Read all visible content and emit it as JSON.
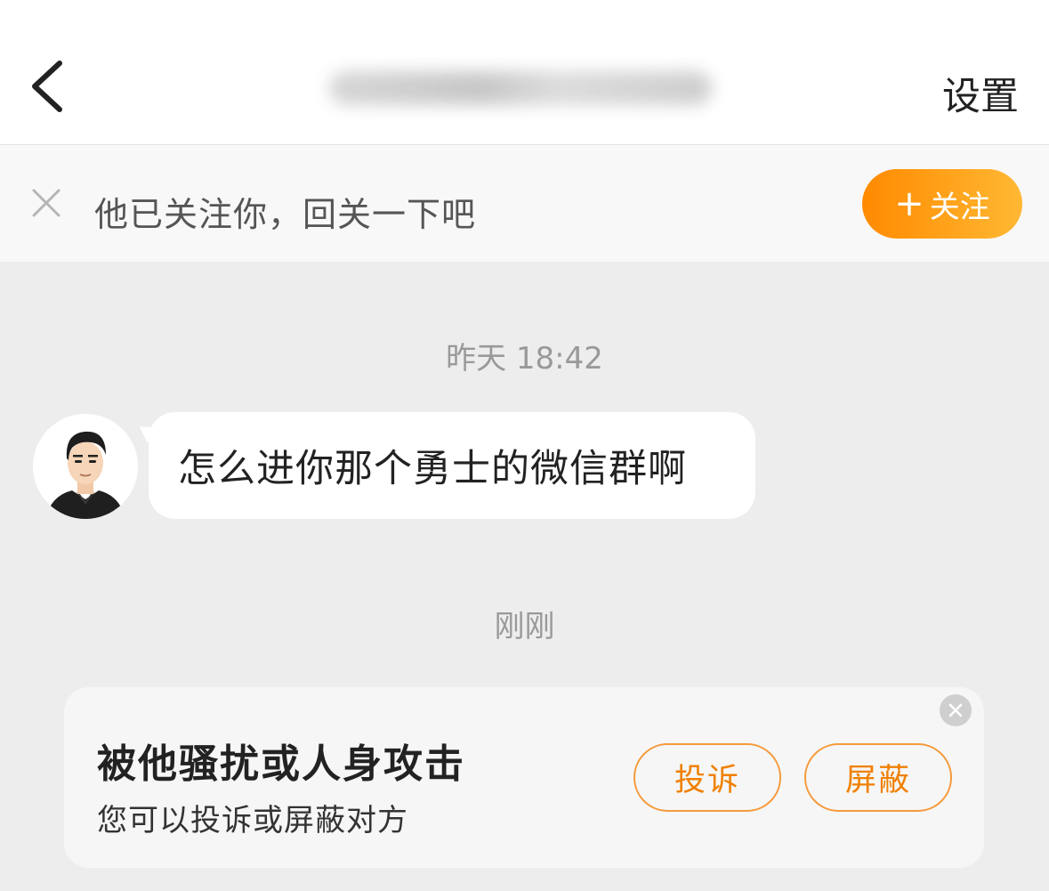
{
  "header": {
    "title": "yofyofyof00000000",
    "settings_label": "设置"
  },
  "follow_banner": {
    "message": "他已关注你，回关一下吧",
    "follow_plus": "+",
    "follow_label": "关注",
    "accent_gradient": [
      "#ff8a00",
      "#ffb833"
    ]
  },
  "chat": {
    "messages": [
      {
        "timestamp": "昨天 18:42",
        "text": "怎么进你那个勇士的微信群啊"
      }
    ],
    "second_timestamp": "刚刚"
  },
  "harassment_card": {
    "title": "被他骚扰或人身攻击",
    "subtitle": "您可以投诉或屏蔽对方",
    "report_label": "投诉",
    "block_label": "屏蔽",
    "button_color": "#f08000"
  },
  "icons": {
    "back": "chevron-left-icon",
    "dismiss": "close-icon",
    "card_close": "close-circle-icon",
    "avatar": "user-avatar-illustration"
  }
}
